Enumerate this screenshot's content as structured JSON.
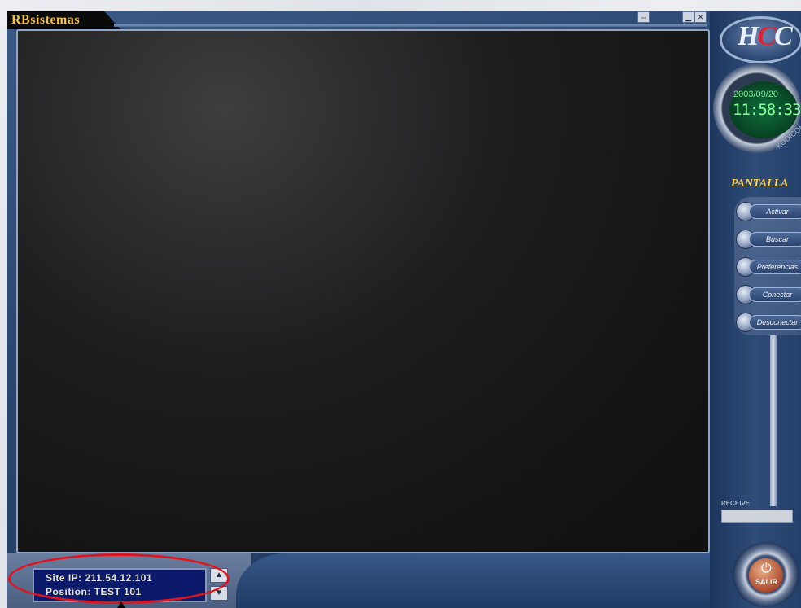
{
  "window": {
    "title": "RBsistemas",
    "controls": {
      "resize_icon": "resize-icon",
      "minimize_icon": "minimize-icon",
      "close_icon": "close-icon"
    }
  },
  "logo": {
    "text_left": "H",
    "text_mid": "C",
    "text_right": "C"
  },
  "clock": {
    "date": "2003/09/20",
    "time": "11:58:33",
    "sublabel": "KODICOM"
  },
  "sidebar": {
    "heading": "PANTALLA",
    "buttons": [
      {
        "label": "Activar"
      },
      {
        "label": "Buscar"
      },
      {
        "label": "Preferencias"
      },
      {
        "label": "Conectar"
      },
      {
        "label": "Desconectar"
      }
    ]
  },
  "receive": {
    "label": "RECEIVE"
  },
  "exit": {
    "label": "SALIR",
    "icon": "power-icon"
  },
  "info": {
    "site_ip": "Site IP: 211.54.12.101",
    "position": "Position: TEST 101"
  },
  "colors": {
    "frame": "#2a4670",
    "title": "#f3c23a",
    "highlight": "#e0141e",
    "clock_text": "#8bff9f"
  }
}
